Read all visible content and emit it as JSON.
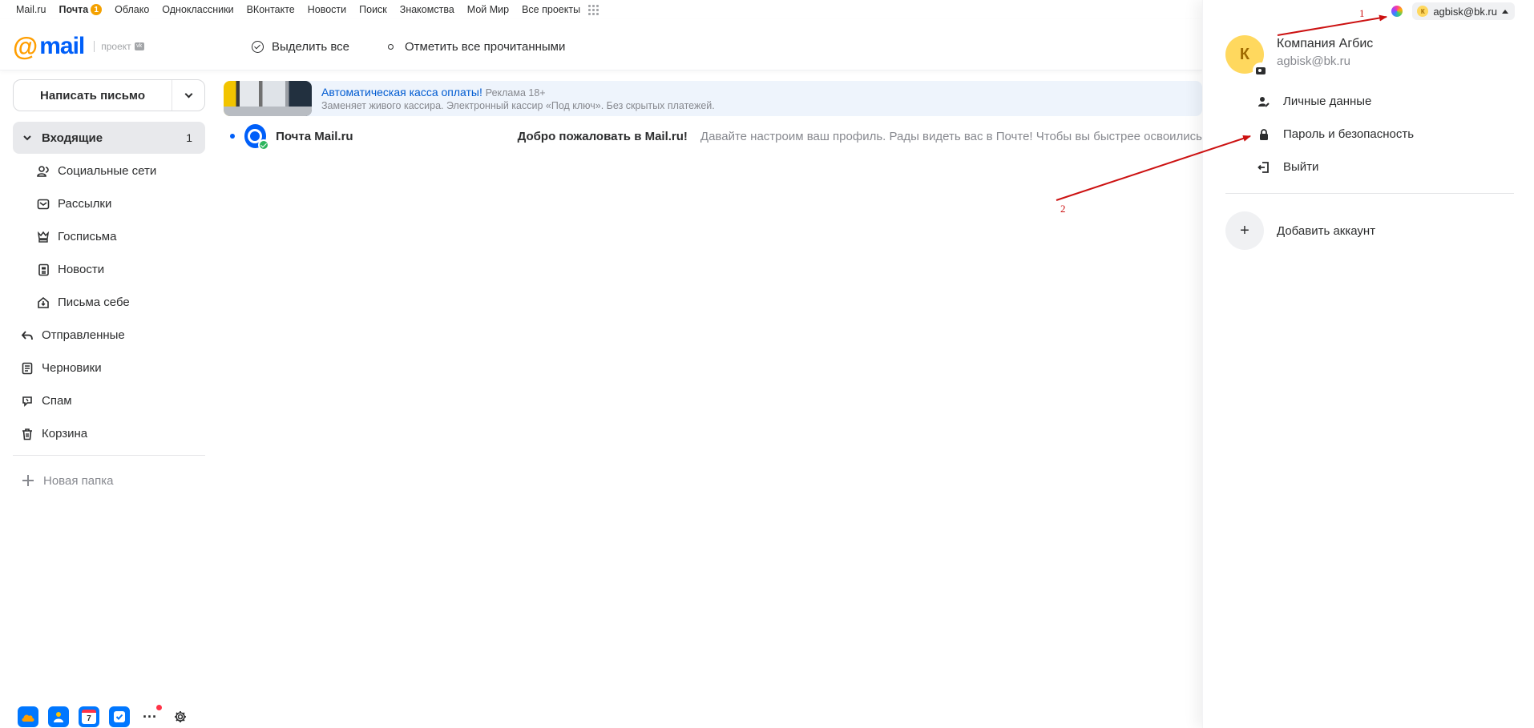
{
  "portal": {
    "links": [
      "Mail.ru",
      "Почта",
      "Облако",
      "Одноклассники",
      "ВКонтакте",
      "Новости",
      "Поиск",
      "Знакомства",
      "Мой Мир",
      "Все проекты"
    ],
    "mail_badge": "1"
  },
  "header": {
    "logo_text": "mail",
    "logo_project": "проект",
    "select_all": "Выделить все",
    "mark_all_read": "Отметить все прочитанными"
  },
  "sidebar": {
    "compose": "Написать письмо",
    "folders": [
      {
        "label": "Входящие",
        "count": "1",
        "icon": "chevron-down-icon"
      },
      {
        "label": "Социальные сети",
        "icon": "social-icon"
      },
      {
        "label": "Рассылки",
        "icon": "newsletter-icon"
      },
      {
        "label": "Госписьма",
        "icon": "gov-icon"
      },
      {
        "label": "Новости",
        "icon": "news-icon"
      },
      {
        "label": "Письма себе",
        "icon": "self-letter-icon"
      },
      {
        "label": "Отправленные",
        "icon": "sent-icon"
      },
      {
        "label": "Черновики",
        "icon": "drafts-icon"
      },
      {
        "label": "Спам",
        "icon": "spam-icon"
      },
      {
        "label": "Корзина",
        "icon": "trash-icon"
      }
    ],
    "new_folder": "Новая папка"
  },
  "dock": {
    "calendar_day": "7",
    "more": "···"
  },
  "ad": {
    "title": "Автоматическая касса оплаты!",
    "tag": "Реклама  18+",
    "description": "Заменяет живого кассира. Электронный кассир «Под ключ». Без скрытых платежей."
  },
  "letters": [
    {
      "sender": "Почта Mail.ru",
      "subject": "Добро пожаловать в Mail.ru!",
      "snippet": "Давайте настроим ваш профиль. Рады видеть вас в Почте! Чтобы вы быстрее освоились"
    }
  ],
  "account": {
    "chip_email": "agbisk@bk.ru",
    "initial": "К",
    "name": "Компания Агбис",
    "email": "agbisk@bk.ru",
    "menu": [
      "Личные данные",
      "Пароль и безопасность",
      "Выйти"
    ],
    "add_account": "Добавить аккаунт"
  },
  "annotations": {
    "label_1": "1",
    "label_2": "2",
    "color": "#cc1111"
  },
  "colors": {
    "brand_blue": "#005ff9",
    "brand_orange": "#ff9e00",
    "avatar_yellow": "#ffd85e"
  }
}
